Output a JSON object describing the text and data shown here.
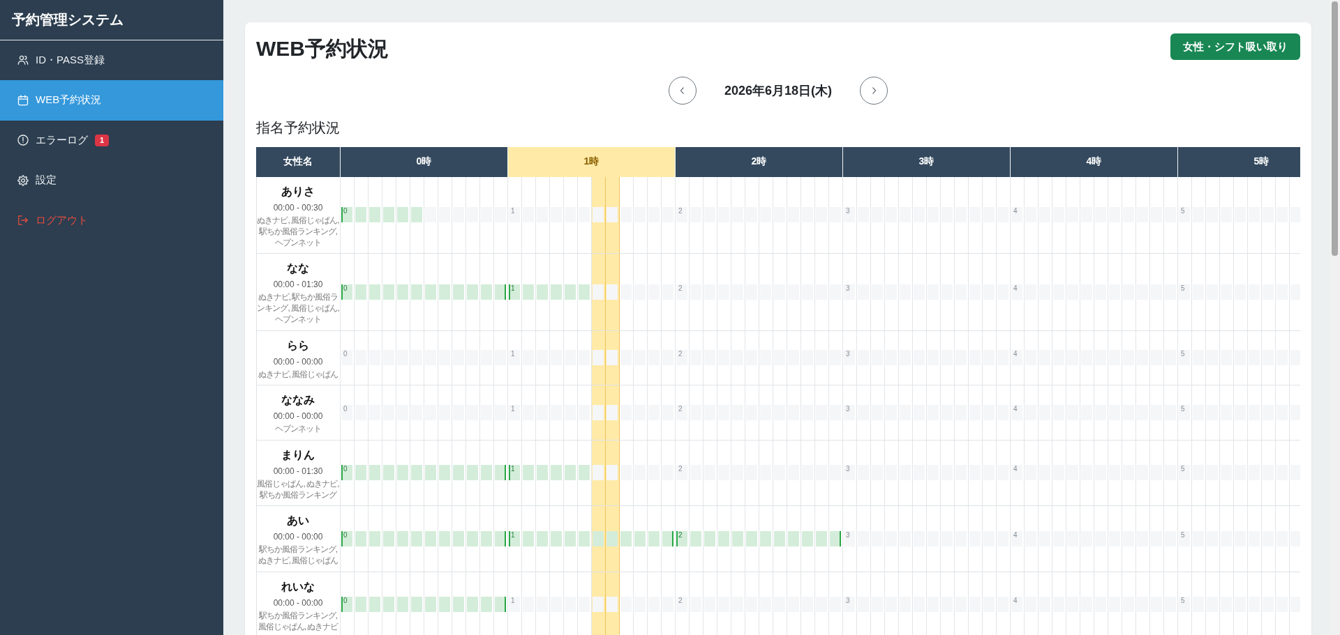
{
  "sidebar": {
    "title": "予約管理システム",
    "items": [
      {
        "label": "ID・PASS登録",
        "kind": "accounts",
        "selected": false
      },
      {
        "label": "WEB予約状況",
        "kind": "reservations",
        "selected": true
      },
      {
        "label": "エラーログ",
        "kind": "errors",
        "selected": false,
        "badge": "1"
      },
      {
        "label": "設定",
        "kind": "settings",
        "selected": false
      },
      {
        "label": "ログアウト",
        "kind": "logout",
        "selected": false
      }
    ]
  },
  "page": {
    "title": "WEB予約状況",
    "action_button": "女性・シフト吸い取り",
    "date": "2026年6月18日(木)",
    "section_title": "指名予約状況"
  },
  "schedule": {
    "name_column": "女性名",
    "hours": [
      {
        "label": "0時",
        "current": false,
        "slot_highlight": [
          false,
          false,
          false,
          false,
          false,
          false,
          false,
          false,
          false,
          false,
          false,
          false
        ]
      },
      {
        "label": "1時",
        "current": true,
        "slot_highlight": [
          false,
          false,
          false,
          false,
          false,
          false,
          true,
          true,
          false,
          false,
          false,
          false
        ]
      },
      {
        "label": "2時",
        "current": false,
        "slot_highlight": [
          false,
          false,
          false,
          false,
          false,
          false,
          false,
          false,
          false,
          false,
          false,
          false
        ]
      },
      {
        "label": "3時",
        "current": false,
        "slot_highlight": [
          false,
          false,
          false,
          false,
          false,
          false,
          false,
          false,
          false,
          false,
          false,
          false
        ]
      },
      {
        "label": "4時",
        "current": false,
        "slot_highlight": [
          false,
          false,
          false,
          false,
          false,
          false,
          false,
          false,
          false,
          false,
          false,
          false
        ]
      },
      {
        "label": "5時",
        "current": false,
        "slot_highlight": [
          false,
          false,
          false,
          false,
          false,
          false,
          false,
          false,
          false
        ]
      }
    ],
    "rows": [
      {
        "name": "ありさ",
        "time": "00:00 - 00:30",
        "sites": "ぬきナビ, 風俗じゃぱん, 駅ちか風俗ランキング, ヘブンネット",
        "hours": [
          {
            "label": "0",
            "level": 0.5
          },
          {
            "label": "1"
          },
          {
            "label": "2"
          },
          {
            "label": "3"
          },
          {
            "label": "4"
          },
          {
            "label": "5"
          }
        ]
      },
      {
        "name": "なな",
        "time": "00:00 - 01:30",
        "sites": "ぬきナビ, 駅ちか風俗ランキング, 風俗じゃぱん, ヘブンネット",
        "hours": [
          {
            "label": "0",
            "level": 1
          },
          {
            "label": "1",
            "level": 0.5
          },
          {
            "label": "2"
          },
          {
            "label": "3"
          },
          {
            "label": "4"
          },
          {
            "label": "5"
          }
        ]
      },
      {
        "name": "らら",
        "time": "00:00 - 00:00",
        "sites": "ぬきナビ, 風俗じゃぱん",
        "hours": [
          {
            "label": "0"
          },
          {
            "label": "1"
          },
          {
            "label": "2"
          },
          {
            "label": "3"
          },
          {
            "label": "4"
          },
          {
            "label": "5"
          }
        ]
      },
      {
        "name": "ななみ",
        "time": "00:00 - 00:00",
        "sites": "ヘブンネット",
        "hours": [
          {
            "label": "0"
          },
          {
            "label": "1"
          },
          {
            "label": "2"
          },
          {
            "label": "3"
          },
          {
            "label": "4"
          },
          {
            "label": "5"
          }
        ]
      },
      {
        "name": "まりん",
        "time": "00:00 - 01:30",
        "sites": "風俗じゃぱん, ぬきナビ, 駅ちか風俗ランキング",
        "hours": [
          {
            "label": "0",
            "level": 1
          },
          {
            "label": "1",
            "level": 0.5
          },
          {
            "label": "2"
          },
          {
            "label": "3"
          },
          {
            "label": "4"
          },
          {
            "label": "5"
          }
        ]
      },
      {
        "name": "あい",
        "time": "00:00 - 00:00",
        "sites": "駅ちか風俗ランキング, ぬきナビ, 風俗じゃぱん",
        "hours": [
          {
            "label": "0",
            "level": 1
          },
          {
            "label": "1",
            "level": 1
          },
          {
            "label": "2",
            "level": 1
          },
          {
            "label": "3"
          },
          {
            "label": "4"
          },
          {
            "label": "5"
          }
        ]
      },
      {
        "name": "れいな",
        "time": "00:00 - 00:00",
        "sites": "駅ちか風俗ランキング, 風俗じゃぱん, ぬきナビ",
        "hours": [
          {
            "label": "0",
            "level": 1
          },
          {
            "label": "1"
          },
          {
            "label": "2"
          },
          {
            "label": "3"
          },
          {
            "label": "4"
          },
          {
            "label": "5"
          }
        ]
      }
    ]
  }
}
